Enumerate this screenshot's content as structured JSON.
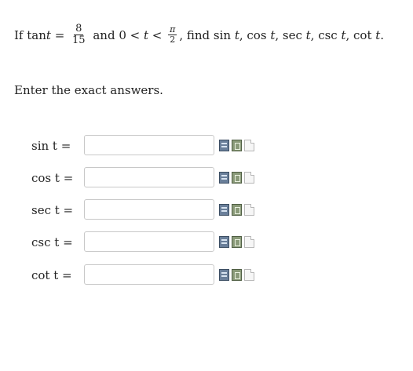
{
  "problem": {
    "if_text": "If tan",
    "var_t": "t",
    "equals": " = ",
    "frac_num": "8",
    "frac_den": "15",
    "and_text": " and 0 < ",
    "t2": "t",
    "lt": " < ",
    "pi_num": "π",
    "pi_den": "2",
    "find_text": ", find sin ",
    "t3": "t",
    "cos_text": ", cos ",
    "t4": "t",
    "sec_text": ", sec ",
    "t5": "t",
    "csc_text": ", csc ",
    "t6": "t",
    "cot_text": ", cot ",
    "t7": "t",
    "period": "."
  },
  "instructions": "Enter the exact answers.",
  "answers": [
    {
      "label": "sin t =",
      "value": ""
    },
    {
      "label": "cos t =",
      "value": ""
    },
    {
      "label": "sec t =",
      "value": ""
    },
    {
      "label": "csc t =",
      "value": ""
    },
    {
      "label": "cot t =",
      "value": ""
    }
  ],
  "tools": {
    "equation_icon": "equation-editor-icon",
    "preview_icon": "preview-icon",
    "hint_icon": "blank-page-icon"
  }
}
